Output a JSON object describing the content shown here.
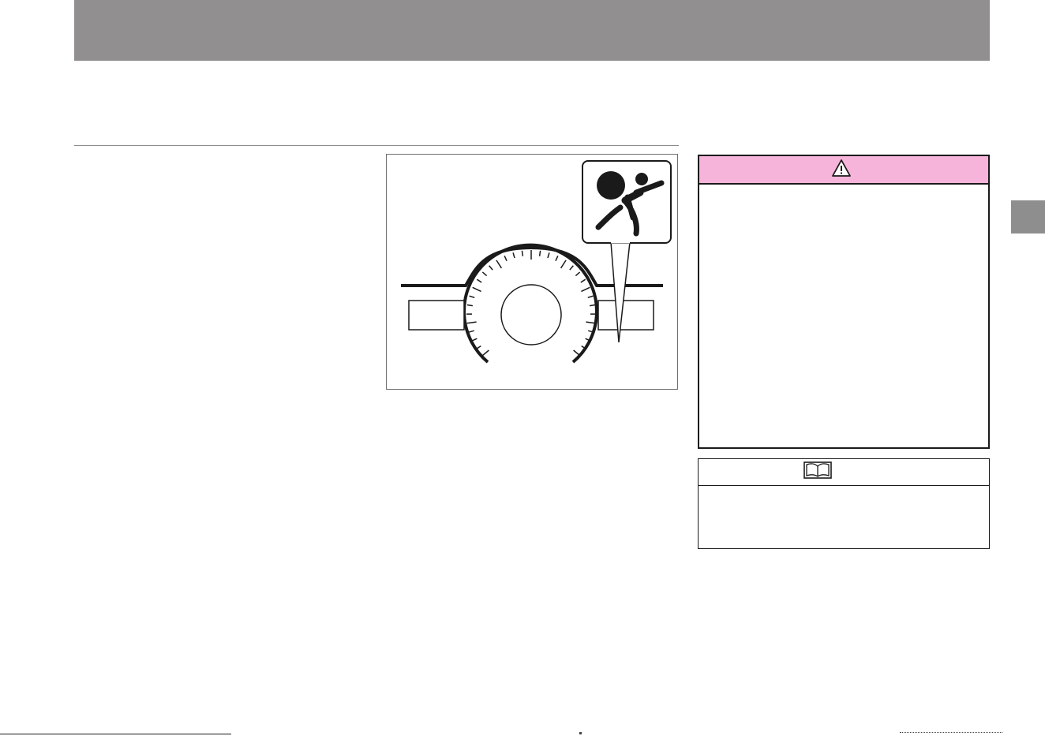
{
  "page": {
    "header_bar_color": "#918f90",
    "warning_header_color": "#f6b4da",
    "side_tab_color": "#8e8e8e"
  },
  "illustration": {
    "callout_symbol": "airbag-warning-symbol",
    "gauge": "speedometer-gauge"
  },
  "warning": {
    "icon": "warning-triangle-icon",
    "title": ""
  },
  "note": {
    "icon": "book-icon",
    "title": ""
  }
}
